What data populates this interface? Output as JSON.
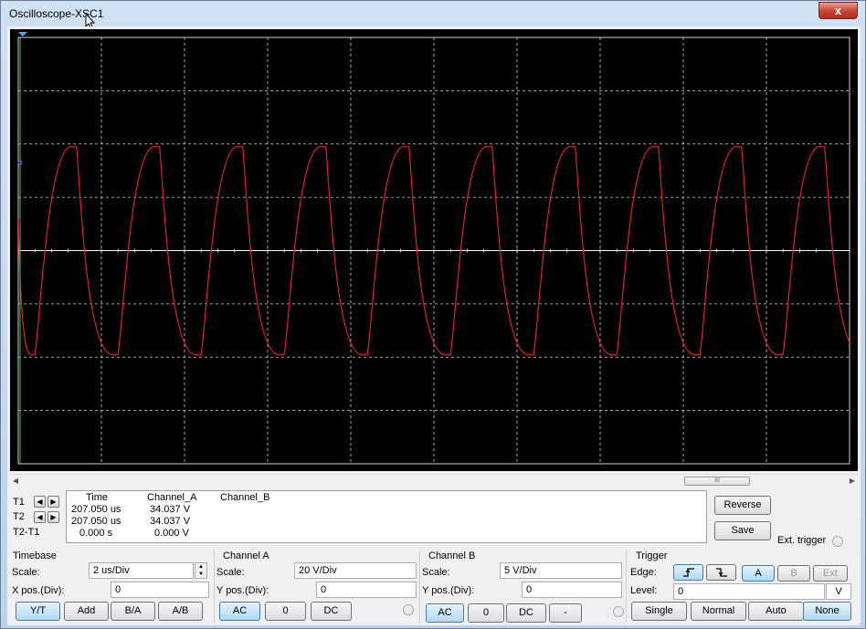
{
  "window": {
    "title": "Oscilloscope-XSC1",
    "close_label": "x"
  },
  "colors": {
    "screen_bg": "#000000",
    "grid": "#d0d0d0",
    "channel_a_trace": "#e02020",
    "channel_b_trace": "#ffffff",
    "selected_button": "#aed8f5"
  },
  "scrollbar": {
    "grip": "III"
  },
  "cursors": [
    {
      "label": "T1"
    },
    {
      "label": "T2"
    },
    {
      "label": "T2-T1"
    }
  ],
  "readout": {
    "headers": {
      "time": "Time",
      "channel_a": "Channel_A",
      "channel_b": "Channel_B"
    },
    "rows": [
      {
        "time": "207.050 us",
        "channel_a": "34.037 V",
        "channel_b": ""
      },
      {
        "time": "207.050 us",
        "channel_a": "34.037 V",
        "channel_b": ""
      },
      {
        "time": "0.000 s",
        "channel_a": "0.000 V",
        "channel_b": ""
      }
    ]
  },
  "actions": {
    "reverse": "Reverse",
    "save": "Save",
    "ext_trigger": "Ext. trigger"
  },
  "timebase": {
    "title": "Timebase",
    "scale_label": "Scale:",
    "scale_value": "2 us/Div",
    "xpos_label": "X pos.(Div):",
    "xpos_value": "0",
    "buttons": [
      "Y/T",
      "Add",
      "B/A",
      "A/B"
    ],
    "selected": "Y/T"
  },
  "channel_a": {
    "title": "Channel A",
    "scale_label": "Scale:",
    "scale_value": "20  V/Div",
    "ypos_label": "Y pos.(Div):",
    "ypos_value": "0",
    "coupling": [
      "AC",
      "0",
      "DC"
    ],
    "selected": "AC"
  },
  "channel_b": {
    "title": "Channel B",
    "scale_label": "Scale:",
    "scale_value": "5  V/Div",
    "ypos_label": "Y pos.(Div):",
    "ypos_value": "0",
    "coupling": [
      "AC",
      "0",
      "DC",
      "-"
    ],
    "selected": "AC"
  },
  "trigger": {
    "title": "Trigger",
    "edge_label": "Edge:",
    "edge_buttons": [
      "rising-edge-icon",
      "falling-edge-icon"
    ],
    "source_buttons": [
      "A",
      "B",
      "Ext"
    ],
    "source_selected": "A",
    "level_label": "Level:",
    "level_value": "0",
    "level_unit": "V",
    "mode_buttons": [
      "Single",
      "Normal",
      "Auto",
      "None"
    ],
    "mode_selected": "None"
  },
  "chart_data": {
    "type": "line",
    "title": "",
    "xlabel": "",
    "ylabel": "",
    "x_divisions": 10,
    "y_divisions": 8,
    "x_unit_per_div": "2 us",
    "y_unit_per_div": "20 V",
    "grid": true,
    "series": [
      {
        "channel": "A",
        "waveform": "square (rounded edges)",
        "period_div": 1.0,
        "high_div": 1.95,
        "low_div": -1.95,
        "offset_div": 0.0
      },
      {
        "channel": "B",
        "waveform": "flat",
        "level_div": 0.0
      }
    ]
  }
}
